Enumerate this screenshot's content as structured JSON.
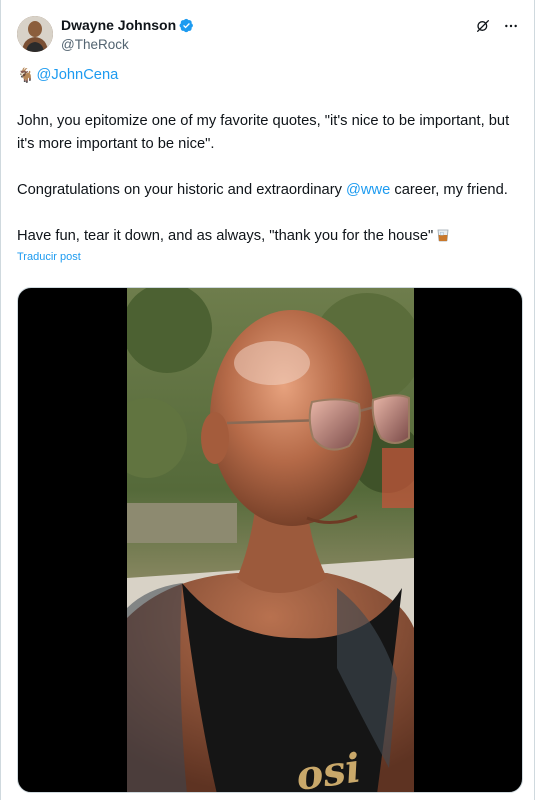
{
  "author": {
    "display_name": "Dwayne Johnson",
    "handle": "@TheRock",
    "verified": true,
    "avatar_icon": "profile-photo"
  },
  "header_actions": [
    "grok-icon",
    "more-options-icon"
  ],
  "tweet": {
    "mention_emoji": "🐐",
    "mention": "@JohnCena",
    "para1": "John, you epitomize one of my favorite quotes, \"it's nice to be important, but it's more important to be nice\".",
    "para2_prefix": "Congratulations on your historic and extraordinary ",
    "para2_link": "@wwe",
    "para2_suffix": " career, my friend.",
    "para3": "Have fun, tear it down, and as always, \"thank you for the house\"",
    "para3_emoji_icon": "whiskey-glass-icon",
    "translate_label": "Traducir post"
  },
  "media": {
    "type": "video",
    "overlay_text": "osi"
  },
  "colors": {
    "link": "#1d9bf0",
    "verified": "#1d9bf0",
    "text": "#0f1419",
    "secondary": "#536471"
  }
}
